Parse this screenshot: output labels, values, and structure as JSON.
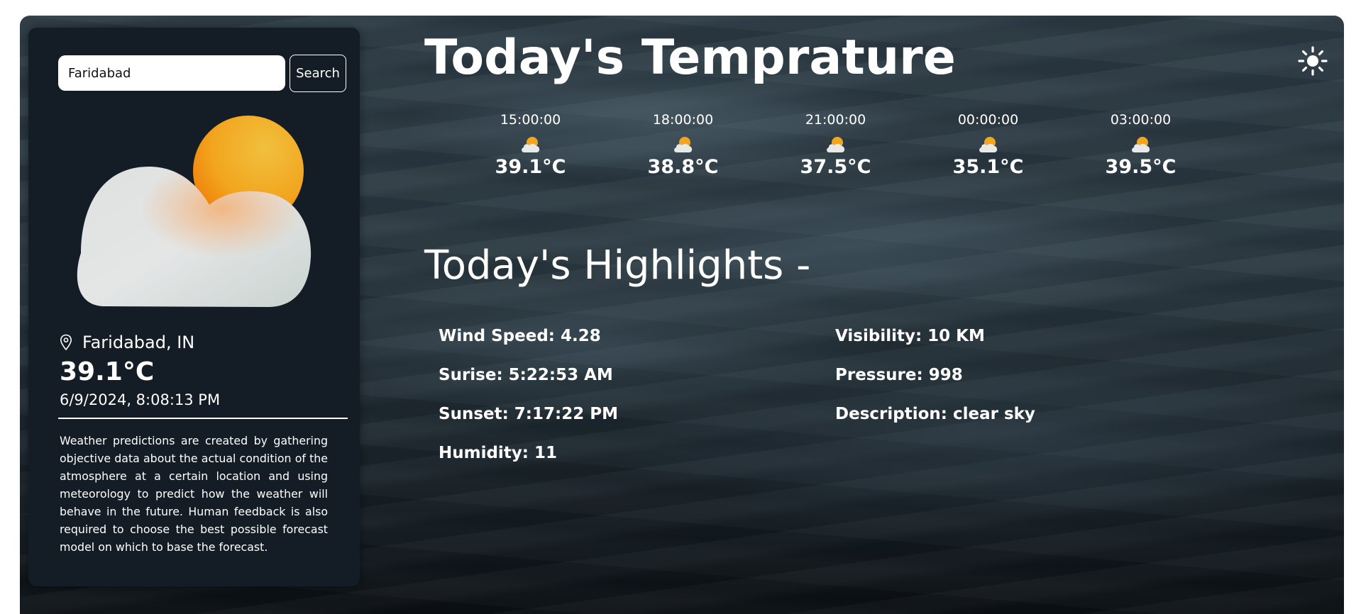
{
  "search": {
    "value": "Faridabad",
    "button_label": "Search"
  },
  "current": {
    "location": "Faridabad, IN",
    "temperature": "39.1°C",
    "datetime": "6/9/2024, 8:08:13 PM",
    "icon": "partly-cloudy-icon"
  },
  "description": "Weather predictions are created by gathering objective data about the actual condition of the atmosphere at a certain location and using meteorology to predict how the weather will behave in the future. Human feedback is also required to choose the best possible forecast model on which to base the forecast.",
  "main": {
    "title": "Today's Temprature",
    "theme_toggle_icon": "sun-icon"
  },
  "forecast": [
    {
      "time": "15:00:00",
      "temp": "39.1°C"
    },
    {
      "time": "18:00:00",
      "temp": "38.8°C"
    },
    {
      "time": "21:00:00",
      "temp": "37.5°C"
    },
    {
      "time": "00:00:00",
      "temp": "35.1°C"
    },
    {
      "time": "03:00:00",
      "temp": "39.5°C"
    }
  ],
  "highlights": {
    "title": "Today's Highlights -",
    "wind_speed": "Wind Speed: 4.28",
    "sunrise": "Surise: 5:22:53 AM",
    "sunset": "Sunset: 7:17:22 PM",
    "humidity": "Humidity: 11",
    "visibility": "Visibility: 10 KM",
    "pressure": "Pressure: 998",
    "description": "Description: clear sky"
  },
  "colors": {
    "panel_bg": "#141c25",
    "sun": "#f5a21a",
    "cloud": "#e6e8e8",
    "text": "#ffffff"
  }
}
